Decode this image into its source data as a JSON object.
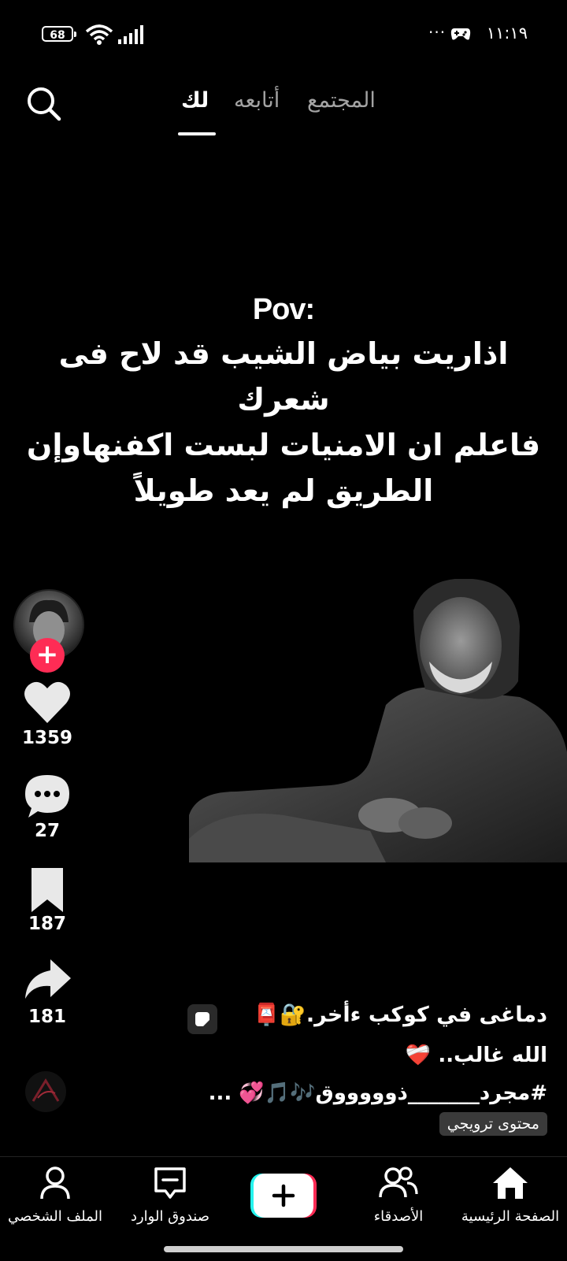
{
  "status_bar": {
    "battery": "68",
    "time": "١١:١٩",
    "more_dots": "···"
  },
  "tabs": [
    {
      "label": "المجتمع",
      "active": false
    },
    {
      "label": "أتابعه",
      "active": false
    },
    {
      "label": "لك",
      "active": true
    }
  ],
  "video": {
    "overlay_title": "Pov:",
    "overlay_lines": [
      "اذاريت بياض الشيب قد لاح فى شعرك",
      "فاعلم ان الامنيات لبست اكفنهاوإن",
      "الطريق لم يعد طويلاً"
    ]
  },
  "actions": {
    "likes": "1359",
    "comments": "27",
    "saves": "187",
    "shares": "181"
  },
  "caption": {
    "line1": "دماغى في كوكب ءأخر.🔐📮",
    "line2": "الله غالب.. ❤️‍🩹",
    "line3": "#مجرد_______ذوووووق🎶🎵💞 ...",
    "promo_label": "محتوى ترويجي"
  },
  "bottom_nav": [
    {
      "label": "الملف الشخصي",
      "icon": "profile-icon"
    },
    {
      "label": "صندوق الوارد",
      "icon": "inbox-icon"
    },
    {
      "label": "",
      "icon": "create-plus-icon"
    },
    {
      "label": "الأصدقاء",
      "icon": "friends-icon"
    },
    {
      "label": "الصفحة الرئيسية",
      "icon": "home-icon"
    }
  ],
  "colors": {
    "accent": "#fe2c55",
    "background": "#000000",
    "create_cyan": "#25f4ee"
  }
}
